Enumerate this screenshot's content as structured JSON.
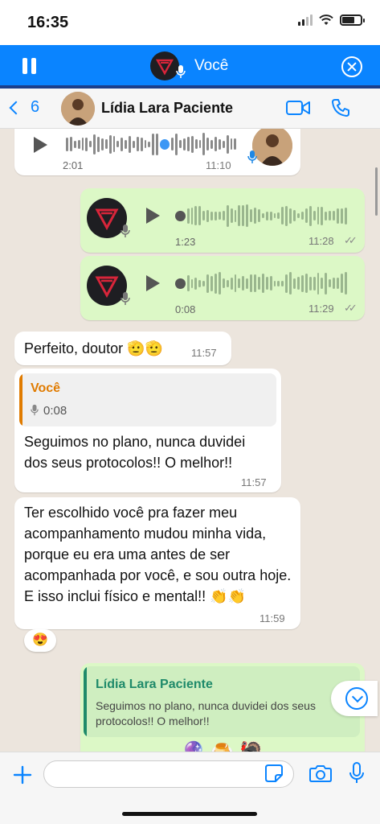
{
  "status_bar": {
    "time": "16:35",
    "battery_level": 0.7
  },
  "voice_player": {
    "title": "Você",
    "progress": 1.0,
    "accent_color": "#0a84ff"
  },
  "header": {
    "back_count": "6",
    "contact_name": "Lídia Lara Paciente"
  },
  "messages": [
    {
      "id": "m1",
      "direction": "incoming",
      "type": "voice",
      "duration": "2:01",
      "time": "11:10"
    },
    {
      "id": "m2",
      "direction": "outgoing",
      "type": "voice",
      "duration": "1:23",
      "time": "11:28"
    },
    {
      "id": "m3",
      "direction": "outgoing",
      "type": "voice",
      "duration": "0:08",
      "time": "11:29"
    },
    {
      "id": "m4",
      "direction": "incoming",
      "type": "text",
      "text": "Perfeito, doutor 🫡🫡",
      "time": "11:57"
    },
    {
      "id": "m5",
      "direction": "incoming",
      "type": "reply",
      "quote": {
        "author": "Você",
        "duration": "0:08",
        "author_color": "#e07b00"
      },
      "text": "Seguimos no plano, nunca duvidei dos seus protocolos!! O melhor!!",
      "time": "11:57"
    },
    {
      "id": "m6",
      "direction": "incoming",
      "type": "text",
      "text": "Ter escolhido você pra fazer meu acompanhamento mudou minha vida, porque eu era uma antes de ser acompanhada por você, e sou outra hoje. E isso inclui físico e mental!! 👏👏",
      "time": "11:59",
      "reaction": "😍"
    },
    {
      "id": "m7",
      "direction": "outgoing",
      "type": "reply",
      "quote": {
        "author": "Lídia Lara Paciente",
        "text": "Seguimos no plano, nunca duvidei dos seus protocolos!! O melhor!!",
        "author_color": "#1f8a6a"
      },
      "emojis": "🔮🍮🦃"
    }
  ],
  "composer": {
    "placeholder": "",
    "value": ""
  },
  "colors": {
    "chat_bg": "#ece5dd",
    "incoming": "#ffffff",
    "outgoing": "#dcf8c6",
    "ios_blue": "#0a84ff"
  },
  "icons": [
    "pause-icon",
    "mic-icon",
    "close-icon",
    "chevron-left-icon",
    "video-call-icon",
    "phone-icon",
    "play-icon",
    "double-check-icon",
    "chevron-down-icon",
    "plus-icon",
    "sticker-icon",
    "camera-icon"
  ]
}
